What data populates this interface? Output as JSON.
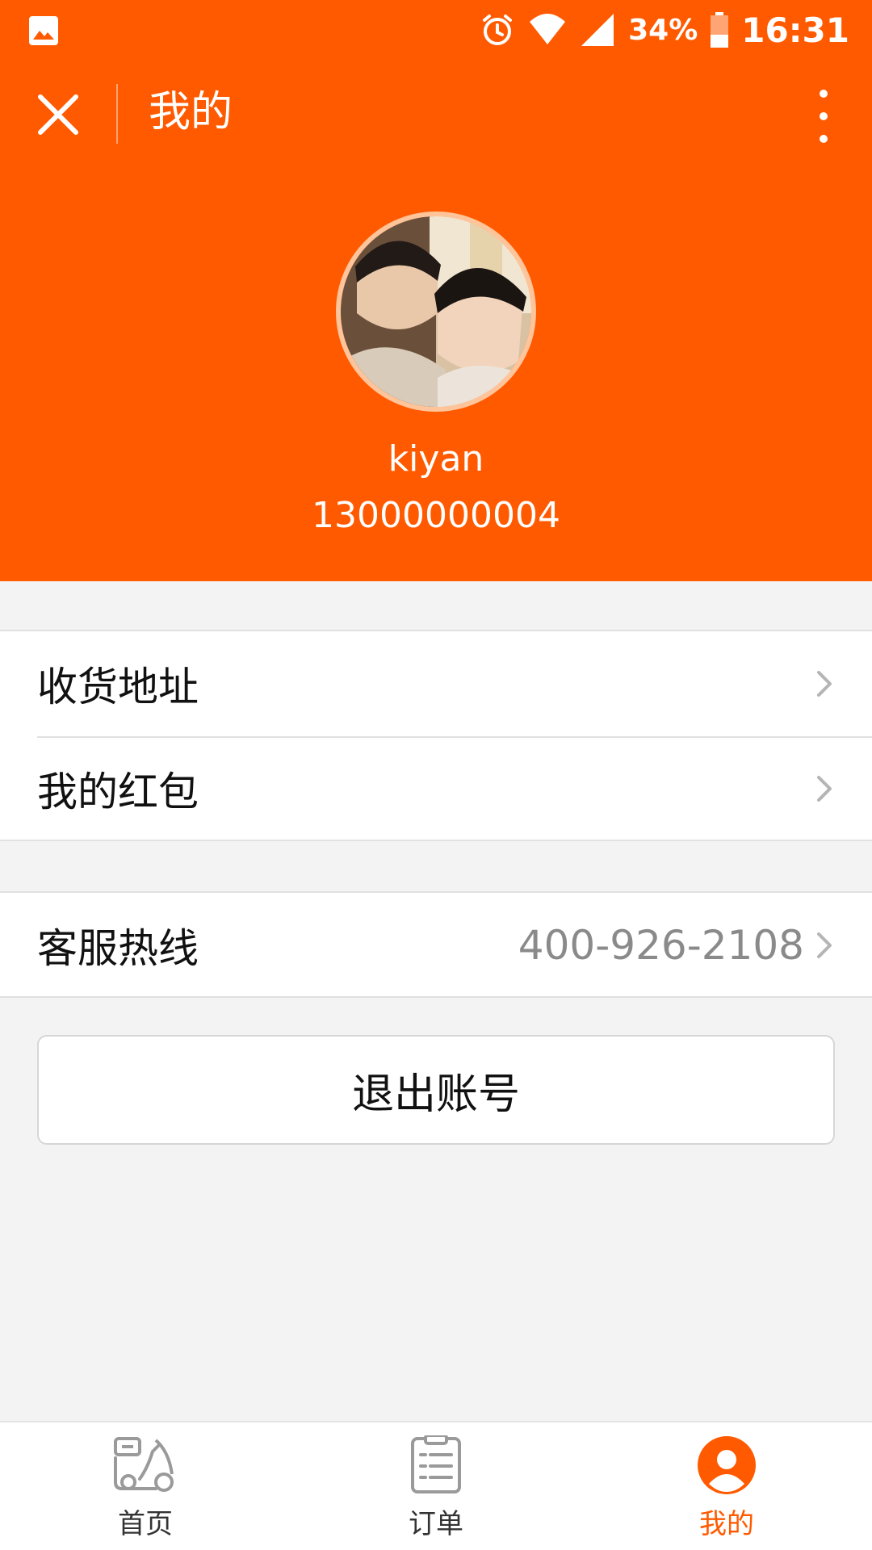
{
  "status_bar": {
    "battery_percent": "34%",
    "time": "16:31",
    "icons": [
      "image-icon",
      "alarm-icon",
      "wifi-icon",
      "signal-icon",
      "battery-icon"
    ]
  },
  "title_bar": {
    "title": "我的",
    "close_icon": "close-icon",
    "more_icon": "more-vertical-icon"
  },
  "profile": {
    "username": "kiyan",
    "phone": "13000000004"
  },
  "menu": {
    "section1": [
      {
        "label": "收货地址"
      },
      {
        "label": "我的红包"
      }
    ],
    "service": {
      "label": "客服热线",
      "value": "400-926-2108"
    }
  },
  "logout_label": "退出账号",
  "tabs": [
    {
      "label": "首页",
      "icon": "scooter-icon"
    },
    {
      "label": "订单",
      "icon": "clipboard-list-icon"
    },
    {
      "label": "我的",
      "icon": "user-icon"
    }
  ],
  "colors": {
    "brand": "#ff5a00",
    "active_tab": "#ff5a00",
    "value_text": "#8a8a8a"
  }
}
